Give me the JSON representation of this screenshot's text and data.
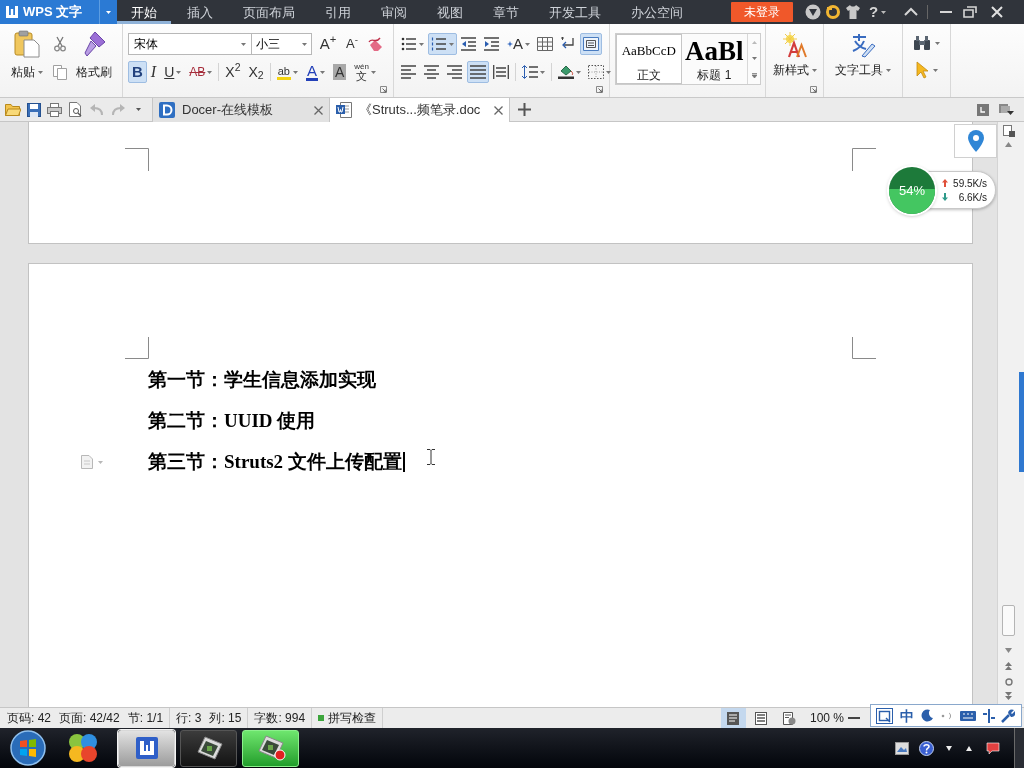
{
  "app_button": {
    "label": "WPS 文字"
  },
  "menu_tabs": [
    {
      "label": "开始",
      "selected": true
    },
    {
      "label": "插入",
      "selected": false
    },
    {
      "label": "页面布局",
      "selected": false
    },
    {
      "label": "引用",
      "selected": false
    },
    {
      "label": "审阅",
      "selected": false
    },
    {
      "label": "视图",
      "selected": false
    },
    {
      "label": "章节",
      "selected": false
    },
    {
      "label": "开发工具",
      "selected": false
    },
    {
      "label": "办公空间",
      "selected": false
    }
  ],
  "login_button": {
    "label": "未登录"
  },
  "help_button": {
    "label": "?"
  },
  "clipboard": {
    "paste_label": "粘贴",
    "format_painter_label": "格式刷"
  },
  "font": {
    "family": "宋体",
    "size": "小三",
    "grow_label": "A$^{+}$",
    "shrink_label": "A$^{-}$"
  },
  "format_buttons": [
    {
      "kind": "bold",
      "label": "B",
      "selected": true,
      "dropdown": false
    },
    {
      "kind": "italic",
      "label": "I",
      "selected": false,
      "dropdown": false
    },
    {
      "kind": "underline",
      "label": "U",
      "selected": false,
      "dropdown": true
    },
    {
      "kind": "strikethrough",
      "label": "AB",
      "selected": false,
      "dropdown": true
    },
    {
      "kind": "superscript",
      "label": "X$^{2}$",
      "selected": false,
      "dropdown": false
    },
    {
      "kind": "subscript",
      "label": "X$_{2}$",
      "selected": false,
      "dropdown": false
    },
    {
      "kind": "highlight",
      "label": "ab",
      "selected": false,
      "dropdown": true
    },
    {
      "kind": "font_color",
      "label": "A",
      "selected": false,
      "dropdown": true
    },
    {
      "kind": "char_shading",
      "label": "A",
      "selected": false,
      "dropdown": false
    },
    {
      "kind": "phonetic",
      "label": "文",
      "ruby": "wén",
      "selected": false,
      "dropdown": true
    }
  ],
  "paragraph_rows": [
    [
      {
        "kind": "bullets",
        "selected": false,
        "dropdown": true
      },
      {
        "kind": "numbering",
        "selected": true,
        "dropdown": true
      },
      {
        "kind": "outdent",
        "selected": false,
        "dropdown": false
      },
      {
        "kind": "indent",
        "selected": false,
        "dropdown": false
      },
      {
        "kind": "text_effect",
        "label": "A",
        "selected": false,
        "dropdown": true
      },
      {
        "kind": "table",
        "selected": false,
        "dropdown": false
      },
      {
        "kind": "line_break",
        "selected": false,
        "dropdown": false
      },
      {
        "kind": "show_marks",
        "selected": true,
        "dropdown": false
      }
    ],
    [
      {
        "kind": "align_left",
        "selected": false,
        "dropdown": false
      },
      {
        "kind": "align_center",
        "selected": false,
        "dropdown": false
      },
      {
        "kind": "align_right",
        "selected": false,
        "dropdown": false
      },
      {
        "kind": "justify",
        "selected": true,
        "dropdown": false
      },
      {
        "kind": "distributed",
        "selected": false,
        "dropdown": false
      },
      {
        "kind": "line_spacing",
        "selected": false,
        "dropdown": true
      },
      {
        "kind": "shading",
        "selected": false,
        "dropdown": true
      },
      {
        "kind": "borders",
        "selected": false,
        "dropdown": true
      }
    ]
  ],
  "styles": [
    {
      "kind": "body",
      "preview": "AaBbCcD",
      "name": "正文",
      "selected": true
    },
    {
      "kind": "heading",
      "preview": "AaBl",
      "name": "标题 1",
      "selected": false
    }
  ],
  "new_style": {
    "label": "新样式"
  },
  "text_tools": {
    "label": "文字工具"
  },
  "doc_tabs": [
    {
      "kind": "docer",
      "title": "Docer-在线模板",
      "selected": false
    },
    {
      "kind": "doc",
      "title": "《Struts...频笔录.doc",
      "selected": true
    }
  ],
  "document": {
    "headings": [
      {
        "text": "第一节：学生信息添加实现",
        "cursor": false
      },
      {
        "text": "第二节：UUID 使用",
        "cursor": false
      },
      {
        "text": "第三节：Struts2 文件上传配置",
        "cursor": true
      }
    ]
  },
  "network_meter": {
    "percent": "54%",
    "level": 0.54,
    "upload": "59.5K/s",
    "download": "6.6K/s"
  },
  "status_bar": {
    "groups": [
      [
        "页码: 42",
        "页面: 42/42",
        "节: 1/1"
      ],
      [
        "行: 3",
        "列: 15"
      ],
      [
        "字数: 994"
      ]
    ],
    "spell_check": {
      "label": "拼写检查",
      "on": true
    },
    "views": [
      {
        "kind": "page",
        "selected": true
      },
      {
        "kind": "outline",
        "selected": false
      },
      {
        "kind": "web",
        "selected": false
      }
    ],
    "zoom": "100 %"
  },
  "ime_bar": {
    "mode": "中"
  },
  "taskbar": {
    "apps": [
      {
        "kind": "wps",
        "selected": true
      },
      {
        "kind": "player",
        "selected": false
      },
      {
        "kind": "recorder",
        "selected": false
      }
    ]
  }
}
